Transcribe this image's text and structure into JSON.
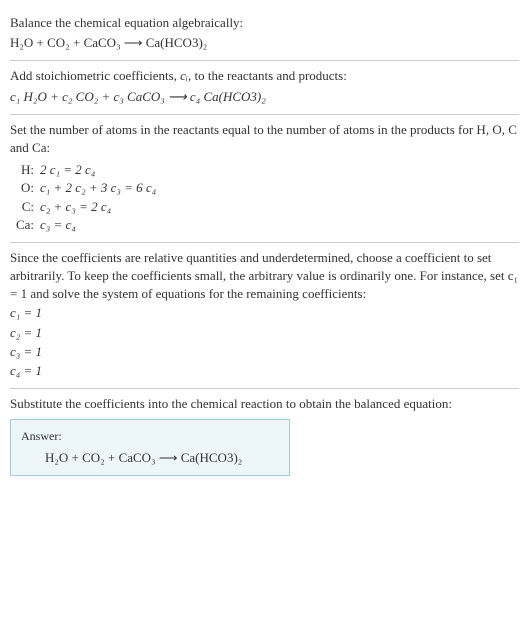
{
  "sec1": {
    "title": "Balance the chemical equation algebraically:",
    "eq": "H₂O + CO₂ + CaCO₃  ⟶  Ca(HCO3)₂"
  },
  "sec2": {
    "title_a": "Add stoichiometric coefficients, ",
    "title_ci": "cᵢ",
    "title_b": ", to the reactants and products:",
    "eq": "c₁ H₂O + c₂ CO₂ + c₃ CaCO₃  ⟶  c₄ Ca(HCO3)₂"
  },
  "sec3": {
    "title": "Set the number of atoms in the reactants equal to the number of atoms in the products for H, O, C and Ca:",
    "rows": [
      {
        "el": "H:",
        "eq": "2 c₁ = 2 c₄"
      },
      {
        "el": "O:",
        "eq": "c₁ + 2 c₂ + 3 c₃ = 6 c₄"
      },
      {
        "el": "C:",
        "eq": "c₂ + c₃ = 2 c₄"
      },
      {
        "el": "Ca:",
        "eq": "c₃ = c₄"
      }
    ]
  },
  "sec4": {
    "title": "Since the coefficients are relative quantities and underdetermined, choose a coefficient to set arbitrarily. To keep the coefficients small, the arbitrary value is ordinarily one. For instance, set c₁ = 1 and solve the system of equations for the remaining coefficients:",
    "coeffs": [
      "c₁ = 1",
      "c₂ = 1",
      "c₃ = 1",
      "c₄ = 1"
    ]
  },
  "sec5": {
    "title": "Substitute the coefficients into the chemical reaction to obtain the balanced equation:"
  },
  "answer": {
    "label": "Answer:",
    "eq": "H₂O + CO₂ + CaCO₃  ⟶  Ca(HCO3)₂"
  }
}
